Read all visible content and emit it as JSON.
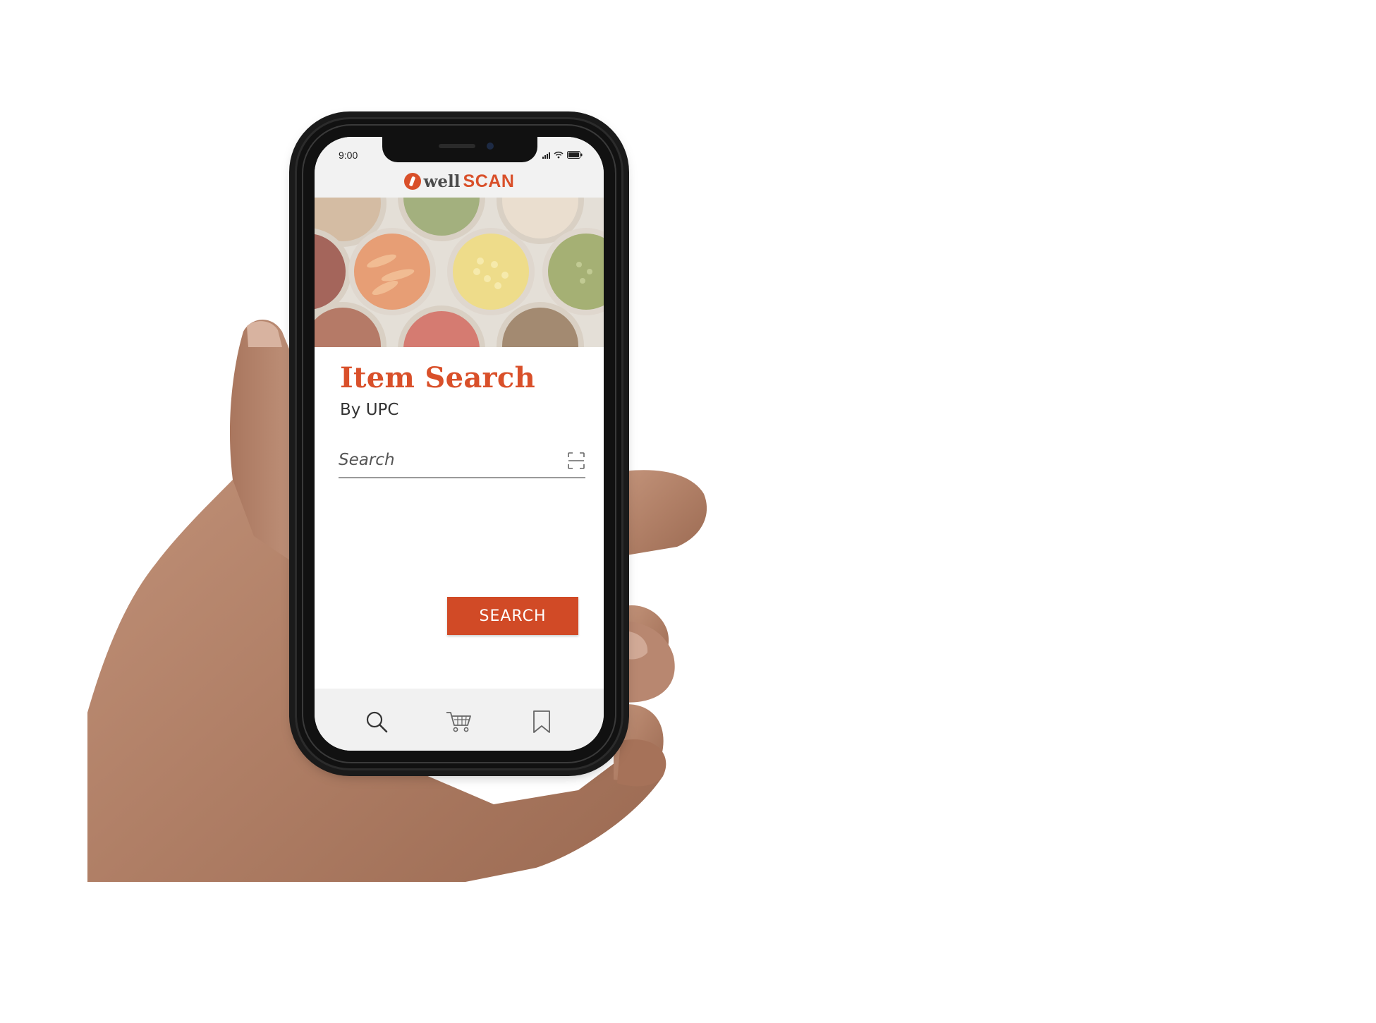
{
  "status_bar": {
    "time": "9:00"
  },
  "header": {
    "logo_word_1": "well",
    "logo_word_2": "SCAN",
    "logo_icon": "wellscan-logo-icon"
  },
  "main": {
    "title": "Item Search",
    "subtitle": "By UPC",
    "search": {
      "placeholder": "Search",
      "value": "",
      "scan_icon": "barcode-scan-icon"
    },
    "search_button_label": "SEARCH"
  },
  "tab_bar": {
    "tabs": [
      {
        "icon": "search-icon",
        "label": ""
      },
      {
        "icon": "cart-icon",
        "label": ""
      },
      {
        "icon": "bookmark-icon",
        "label": ""
      }
    ]
  },
  "colors": {
    "brand": "#d9502a",
    "button": "#d14a26",
    "text_dark": "#333333",
    "tab_bar_bg": "#f1f1f1"
  }
}
